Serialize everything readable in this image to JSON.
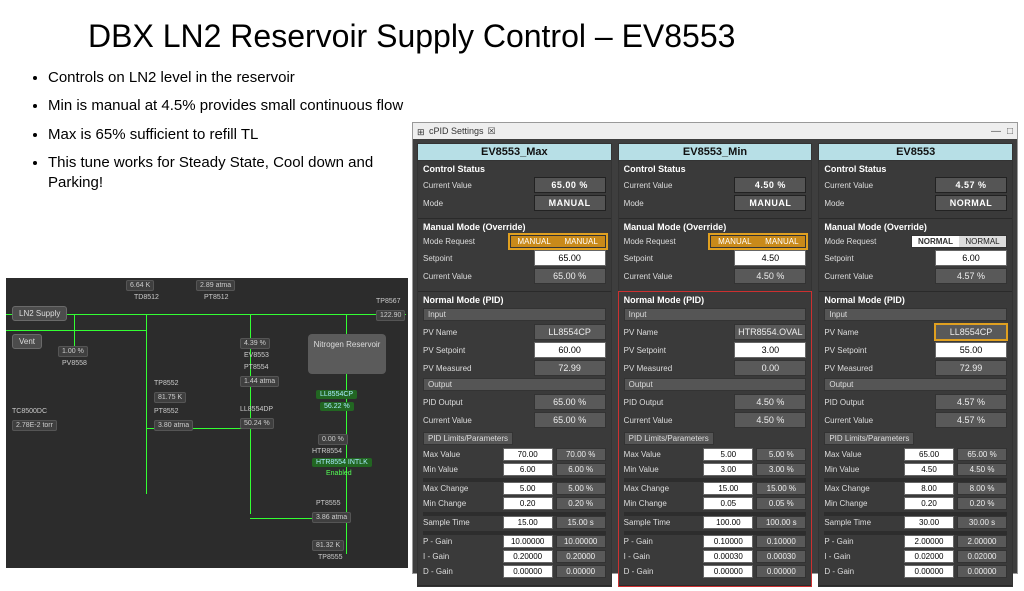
{
  "title": "DBX LN2 Reservoir Supply Control – EV8553",
  "bullets": [
    "Controls on LN2 level in the reservoir",
    "Min is manual at 4.5% provides small continuous flow",
    "Max is 65% sufficient to refill TL",
    "This tune works for Steady State, Cool down and Parking!"
  ],
  "window": {
    "title": "cPID Settings",
    "icon": "☒"
  },
  "diagram": {
    "supply": "LN2 Supply",
    "vent": "Vent",
    "pv8558": {
      "val": "1.00 %",
      "lbl": "PV8558"
    },
    "top_temp": "6.64 K",
    "top_torr": "2.89 atma",
    "td8512": "TD8512",
    "pt8512": "PT8512",
    "tp8567": "TP8567",
    "tp8567v": "122.90",
    "tc8500dc": "TC8500DC",
    "tc8500v": "2.78E-2 torr",
    "tp8552": {
      "lbl": "TP8552",
      "v": "81.75 K"
    },
    "pt8552": {
      "lbl": "PT8552",
      "v": "3.80 atma"
    },
    "ev8553": "EV8553",
    "ev8553v": "4.39 %",
    "pt8554": "PT8554",
    "pt8554v": "1.44 atma",
    "ll8554dp": "LL8554DP",
    "ll8554dpv": "50.24 %",
    "nitro": "Nitrogen Reservoir",
    "ll8554cp": "LL8554CP",
    "ll8554cpv": "56.22 %",
    "zero": "0.00 %",
    "htr8554": "HTR8554",
    "intlk": "HTR8554 INTLK",
    "enabled": "Enabled",
    "pt8555": "PT8555",
    "pt8555v": "3.86 atma",
    "bottom_k": "81.32 K",
    "tp8555": "TP8555"
  },
  "labels": {
    "control_status": "Control Status",
    "current_value": "Current Value",
    "mode": "Mode",
    "manual_override": "Manual Mode (Override)",
    "mode_request": "Mode Request",
    "setpoint": "Setpoint",
    "normal_pid": "Normal Mode (PID)",
    "input": "Input",
    "pv_name": "PV Name",
    "pv_setpoint": "PV Setpoint",
    "pv_measured": "PV Measured",
    "output": "Output",
    "pid_output": "PID Output",
    "limits": "PID Limits/Parameters",
    "max_value": "Max Value",
    "min_value": "Min Value",
    "max_change": "Max Change",
    "min_change": "Min Change",
    "sample_time": "Sample Time",
    "p_gain": "P - Gain",
    "i_gain": "I - Gain",
    "d_gain": "D - Gain",
    "manual": "MANUAL",
    "normal": "NORMAL"
  },
  "col1": {
    "name": "EV8553_Max",
    "cv": "65.00 %",
    "mode": "MANUAL",
    "toggle_l": "MANUAL",
    "toggle_r": "MANUAL",
    "sp_in": "65.00",
    "cv2": "65.00 %",
    "pvname": "LL8554CP",
    "pvsp_in": "60.00",
    "pvm": "72.99",
    "pidout": "65.00 %",
    "cv3": "65.00 %",
    "maxv_in": "70.00",
    "maxv_r": "70.00 %",
    "minv_in": "6.00",
    "minv_r": "6.00 %",
    "maxc_in": "5.00",
    "maxc_r": "5.00 %",
    "minc_in": "0.20",
    "minc_r": "0.20 %",
    "st_in": "15.00",
    "st_r": "15.00 s",
    "p_in": "10.00000",
    "p_r": "10.00000",
    "i_in": "0.20000",
    "i_r": "0.20000",
    "d_in": "0.00000",
    "d_r": "0.00000"
  },
  "col2": {
    "name": "EV8553_Min",
    "cv": "4.50 %",
    "mode": "MANUAL",
    "toggle_l": "MANUAL",
    "toggle_r": "MANUAL",
    "sp_in": "4.50",
    "cv2": "4.50 %",
    "pvname": "HTR8554.OVAL",
    "pvsp_in": "3.00",
    "pvm": "0.00",
    "pidout": "4.50 %",
    "cv3": "4.50 %",
    "maxv_in": "5.00",
    "maxv_r": "5.00 %",
    "minv_in": "3.00",
    "minv_r": "3.00 %",
    "maxc_in": "15.00",
    "maxc_r": "15.00 %",
    "minc_in": "0.05",
    "minc_r": "0.05 %",
    "st_in": "100.00",
    "st_r": "100.00 s",
    "p_in": "0.10000",
    "p_r": "0.10000",
    "i_in": "0.00030",
    "i_r": "0.00030",
    "d_in": "0.00000",
    "d_r": "0.00000"
  },
  "col3": {
    "name": "EV8553",
    "cv": "4.57 %",
    "mode": "NORMAL",
    "toggle_l": "NORMAL",
    "toggle_r": "NORMAL",
    "sp_in": "6.00",
    "cv2": "4.57 %",
    "pvname": "LL8554CP",
    "pvsp_in": "55.00",
    "pvm": "72.99",
    "pidout": "4.57 %",
    "cv3": "4.57 %",
    "maxv_in": "65.00",
    "maxv_r": "65.00 %",
    "minv_in": "4.50",
    "minv_r": "4.50 %",
    "maxc_in": "8.00",
    "maxc_r": "8.00 %",
    "minc_in": "0.20",
    "minc_r": "0.20 %",
    "st_in": "30.00",
    "st_r": "30.00 s",
    "p_in": "2.00000",
    "p_r": "2.00000",
    "i_in": "0.02000",
    "i_r": "0.02000",
    "d_in": "0.00000",
    "d_r": "0.00000"
  }
}
